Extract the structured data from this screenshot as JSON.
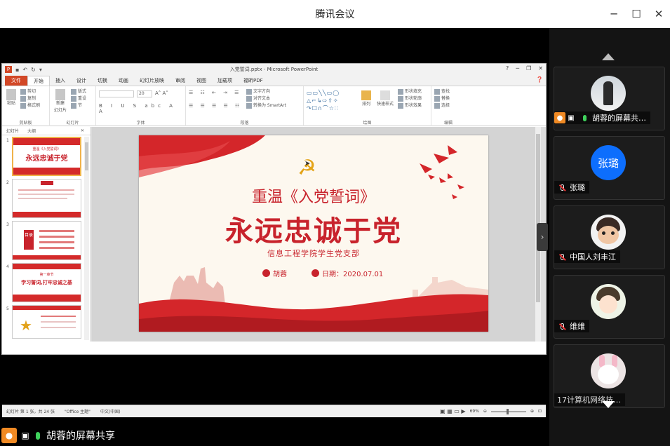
{
  "window": {
    "title": "腾讯会议"
  },
  "ppt": {
    "doc_title": "入党誓词.pptx - Microsoft PowerPoint",
    "tabs": [
      "文件",
      "开始",
      "插入",
      "设计",
      "切换",
      "动画",
      "幻灯片放映",
      "审阅",
      "视图",
      "加载项",
      "福昕PDF"
    ],
    "active_tab": "开始",
    "ribbon": {
      "clipboard": {
        "label": "剪贴板",
        "paste": "粘贴",
        "cut": "剪切",
        "copy": "复制",
        "format_painter": "格式刷"
      },
      "slides": {
        "label": "幻灯片",
        "new_slide": "新建\n幻灯片",
        "layout": "版式",
        "reset": "重设",
        "section": "节"
      },
      "font": {
        "label": "字体",
        "size": "20"
      },
      "paragraph": {
        "label": "段落",
        "text_direction": "文字方向",
        "align_text": "对齐文本",
        "smartart": "转换为 SmartArt"
      },
      "drawing": {
        "label": "绘图",
        "arrange": "排列",
        "quick_styles": "快速样式",
        "fill": "形状填充",
        "outline": "形状轮廓",
        "effects": "形状效果"
      },
      "editing": {
        "label": "编辑",
        "find": "查找",
        "replace": "替换",
        "select": "选择"
      }
    },
    "panel_tabs": [
      "幻灯片",
      "大纲"
    ],
    "thumbnails": [
      {
        "num": "1",
        "title": "永远忠诚于党",
        "sub": "重温《入党誓词》"
      },
      {
        "num": "2",
        "title": "",
        "sub": ""
      },
      {
        "num": "3",
        "title": "目录",
        "sub": ""
      },
      {
        "num": "4",
        "title": "学习誓词,打牢忠诚之基",
        "sub": "第一章节"
      },
      {
        "num": "5",
        "title": "",
        "sub": ""
      }
    ],
    "status": {
      "slide": "幻灯片 第 1 张，共 24 张",
      "theme": "\"Office 主题\"",
      "lang": "中文(中国)",
      "zoom": "69%"
    }
  },
  "slide": {
    "subtitle": "重温《入党誓词》",
    "title": "永远忠诚于党",
    "org": "信息工程学院学生党支部",
    "author": "胡蓉",
    "date": "日期：2020.07.01"
  },
  "participants": [
    {
      "name": "胡蓉的屏幕共…",
      "avatar": "photo",
      "mic": "on",
      "sharing": true
    },
    {
      "name": "张璐",
      "avatar_text": "张璐",
      "avatar": "text",
      "mic": "off"
    },
    {
      "name": "中国人刘丰江",
      "avatar": "cartoon",
      "mic": "off"
    },
    {
      "name": "维维",
      "avatar": "anime",
      "mic": "off"
    },
    {
      "name": "17计算机网络技…",
      "avatar": "bunny",
      "mic": "none"
    }
  ],
  "bottom": {
    "share_label": "胡蓉的屏幕共享"
  },
  "colors": {
    "accent_red": "#c8232c",
    "tencent_blue": "#0d6efd",
    "sharing_orange": "#f08a24"
  }
}
